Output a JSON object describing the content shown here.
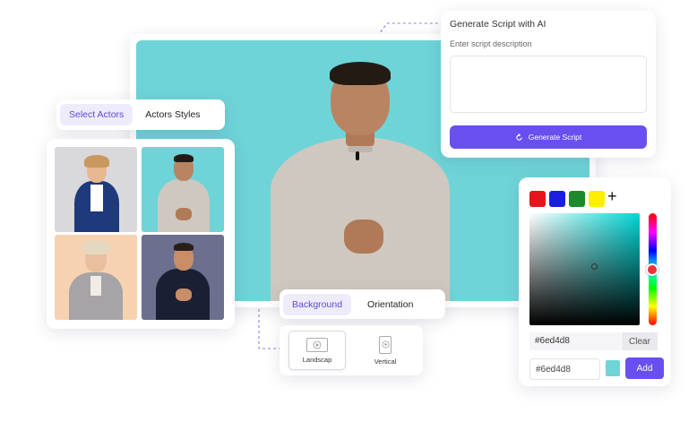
{
  "colors": {
    "accent": "#6a4ff0",
    "stage_bg": "#6ed4d8",
    "selected_color": "#6ed4d8"
  },
  "actors_tabs": {
    "select_actors": "Select Actors",
    "actors_styles": "Actors Styles"
  },
  "actors": [
    {
      "name": "actor-woman-blue-blazer",
      "bg": "#d9d9dc"
    },
    {
      "name": "actor-man-grey-sweater",
      "bg": "#6ed4d8"
    },
    {
      "name": "actor-woman-grey-suit",
      "bg": "#f7d2b0"
    },
    {
      "name": "actor-man-navy-polo",
      "bg": "#6c6f8e"
    }
  ],
  "script": {
    "title": "Generate Script with AI",
    "description_label": "Enter script description",
    "textarea_value": "",
    "button_label": "Generate Script",
    "button_icon": "refresh-icon"
  },
  "bg_tabs": {
    "background": "Background",
    "orientation": "Orientation"
  },
  "orientation": {
    "landscape": "Landscap",
    "vertical": "Vertical",
    "selected": "Landscap"
  },
  "picker": {
    "swatches": [
      "#e8141c",
      "#1a1ee0",
      "#1c8a2a",
      "#ffee00"
    ],
    "add_swatch_symbol": "+",
    "hex_display": "#6ed4d8",
    "clear_label": "Clear",
    "hex_input": "#6ed4d8",
    "add_label": "Add"
  }
}
